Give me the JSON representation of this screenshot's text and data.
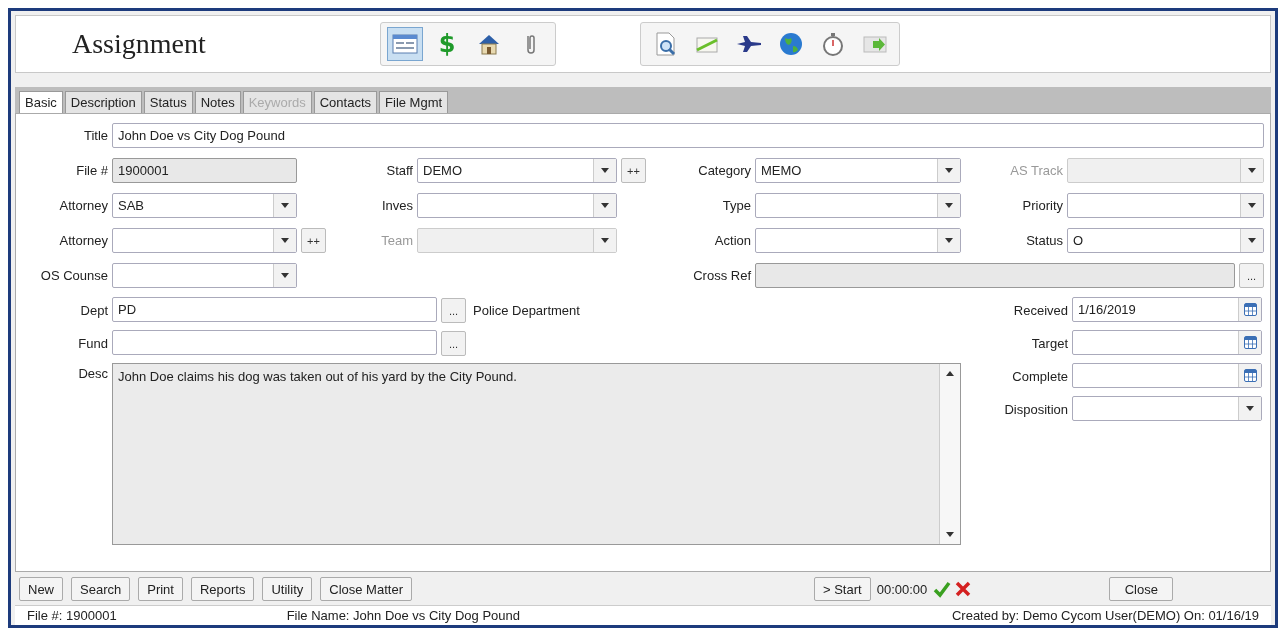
{
  "window": {
    "title": "Assignment"
  },
  "toolbar_groups": [
    {
      "buttons": [
        {
          "selected": true
        },
        {
          "glyph": "$",
          "selected": false
        },
        {
          "selected": false
        },
        {
          "selected": false
        }
      ]
    },
    {
      "buttons": [
        {
          "selected": false
        },
        {
          "selected": false
        },
        {
          "selected": false
        },
        {
          "selected": false
        },
        {
          "selected": false
        },
        {
          "selected": false
        }
      ]
    }
  ],
  "tabs": [
    {
      "label": "Basic",
      "selected": true,
      "disabled": false
    },
    {
      "label": "Description",
      "selected": false,
      "disabled": false
    },
    {
      "label": "Status",
      "selected": false,
      "disabled": false
    },
    {
      "label": "Notes",
      "selected": false,
      "disabled": false
    },
    {
      "label": "Keywords",
      "selected": false,
      "disabled": true
    },
    {
      "label": "Contacts",
      "selected": false,
      "disabled": false
    },
    {
      "label": "File Mgmt",
      "selected": false,
      "disabled": false
    }
  ],
  "fields": [
    {
      "label": "Title",
      "kind": "text",
      "value": "John Doe vs City Dog Pound",
      "disabled": false
    },
    {
      "label": "File #",
      "kind": "readonly",
      "value": "1900001",
      "disabled": false
    },
    {
      "label": "Staff",
      "kind": "combo",
      "value": "DEMO",
      "disabled": false,
      "add_button": "++"
    },
    {
      "label": "Category",
      "kind": "combo",
      "value": "MEMO",
      "disabled": false
    },
    {
      "label": "AS Track",
      "kind": "combo",
      "disabled": true
    },
    {
      "label": "Attorney",
      "kind": "combo",
      "value": "SAB",
      "disabled": false
    },
    {
      "label": "Inves",
      "kind": "combo",
      "disabled": false
    },
    {
      "label": "Type",
      "kind": "combo",
      "disabled": false
    },
    {
      "label": "Priority",
      "kind": "combo",
      "disabled": false
    },
    {
      "label": "Attorney",
      "kind": "combo",
      "disabled": false,
      "add_button": "++"
    },
    {
      "label": "Team",
      "kind": "combo",
      "disabled": true
    },
    {
      "label": "Action",
      "kind": "combo",
      "disabled": false
    },
    {
      "label": "Status",
      "kind": "combo",
      "value": "O",
      "disabled": false
    },
    {
      "label": "OS Counse",
      "kind": "combo",
      "disabled": false
    },
    {
      "label": "Cross Ref",
      "kind": "readonly",
      "disabled": false,
      "browse_button": "..."
    }
  ],
  "lower_left": [
    {
      "label": "Dept",
      "value": "PD",
      "browse_button": "...",
      "note": "Police Department"
    },
    {
      "label": "Fund",
      "browse_button": "..."
    }
  ],
  "description": {
    "label": "Desc",
    "value": "John Doe claims his dog was taken out of his yard by the City Pound."
  },
  "dates": [
    {
      "label": "Received",
      "kind": "date",
      "value": "1/16/2019"
    },
    {
      "label": "Target",
      "kind": "date"
    },
    {
      "label": "Complete",
      "kind": "date"
    },
    {
      "label": "Disposition",
      "kind": "combo"
    }
  ],
  "bottom_buttons": [
    "New",
    "Search",
    "Print",
    "Reports",
    "Utility",
    "Close Matter"
  ],
  "timer": {
    "start_button": "> Start",
    "time": "00:00:00"
  },
  "close_button": "Close",
  "status_bar": [
    "File #: 1900001",
    "File Name: John Doe vs City Dog Pound",
    "Created by: Demo Cycom User(DEMO) On: 01/16/19"
  ]
}
